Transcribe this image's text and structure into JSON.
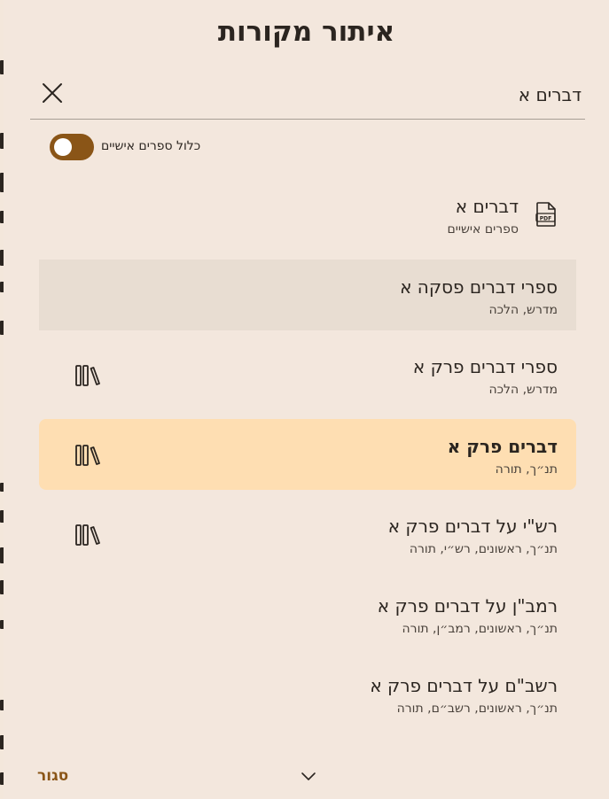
{
  "dialog": {
    "title": "איתור מקורות"
  },
  "search": {
    "value": "דברים א"
  },
  "toggle": {
    "label": "כלול ספרים אישיים",
    "on": true
  },
  "results": [
    {
      "title": "דברים א",
      "subtitle": "ספרים אישיים",
      "icon": "pdf-icon"
    },
    {
      "title": "ספרי דברים פסקה א",
      "subtitle": "מדרש, הלכה",
      "icon": ""
    },
    {
      "title": "ספרי דברים פרק א",
      "subtitle": "מדרש, הלכה",
      "icon": "library-icon"
    },
    {
      "title": "דברים פרק א",
      "subtitle": "תנ״ך, תורה",
      "icon": "library-icon"
    },
    {
      "title": "רש\"י על דברים פרק א",
      "subtitle": "תנ״ך, ראשונים, רש״י, תורה",
      "icon": "library-icon"
    },
    {
      "title": "רמב\"ן על דברים פרק א",
      "subtitle": "תנ״ך, ראשונים, רמב״ן, תורה",
      "icon": ""
    },
    {
      "title": "רשב\"ם על דברים פרק א",
      "subtitle": "תנ״ך, ראשונים, רשב״ם, תורה",
      "icon": ""
    }
  ],
  "footer": {
    "close_label": "סגור"
  },
  "colors": {
    "accent": "#8a5517",
    "selected_row": "#fedeb2",
    "hover_row": "#e8ddd2",
    "dialog_bg": "#f3e7dd"
  }
}
